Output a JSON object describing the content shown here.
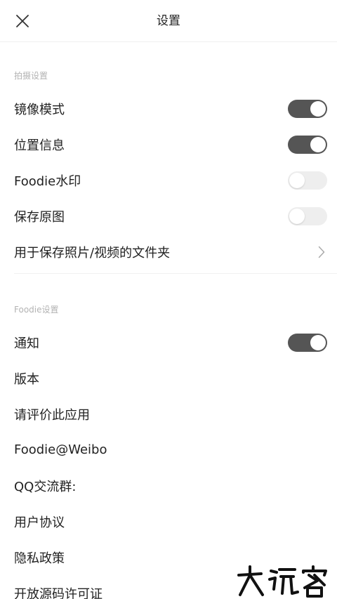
{
  "header": {
    "title": "设置",
    "close_icon": "close-icon"
  },
  "sections": [
    {
      "title": "拍摄设置",
      "items": [
        {
          "label": "镜像模式",
          "type": "toggle",
          "on": true
        },
        {
          "label": "位置信息",
          "type": "toggle",
          "on": true
        },
        {
          "label": "Foodie水印",
          "type": "toggle",
          "on": false
        },
        {
          "label": "保存原图",
          "type": "toggle",
          "on": false
        },
        {
          "label": "用于保存照片/视频的文件夹",
          "type": "link",
          "icon": "chevron-right-icon"
        }
      ]
    },
    {
      "title": "Foodie设置",
      "items": [
        {
          "label": "通知",
          "type": "toggle",
          "on": true
        },
        {
          "label": "版本",
          "type": "text"
        },
        {
          "label": "请评价此应用",
          "type": "text"
        },
        {
          "label": "Foodie@Weibo",
          "type": "text"
        },
        {
          "label": "QQ交流群:",
          "type": "text"
        },
        {
          "label": "用户协议",
          "type": "text"
        },
        {
          "label": "隐私政策",
          "type": "text"
        },
        {
          "label": "开放源码许可证",
          "type": "text"
        }
      ]
    }
  ],
  "colors": {
    "toggle_on": "#555555",
    "toggle_off": "#eeeeee",
    "section_header": "#b3b3b3"
  }
}
